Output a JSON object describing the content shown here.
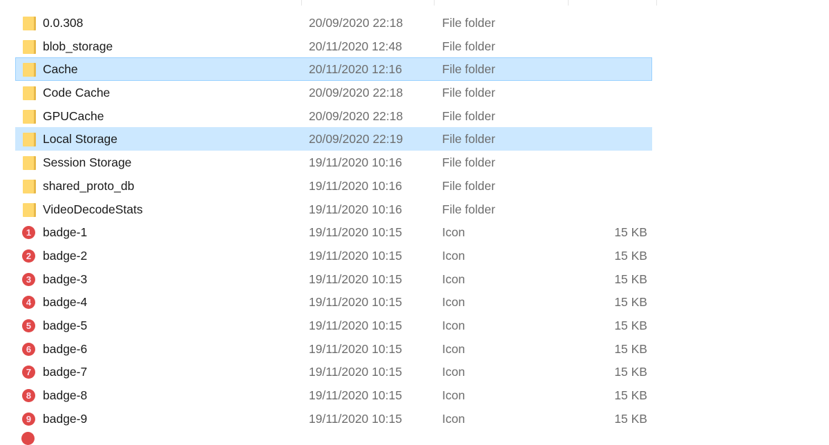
{
  "accent_selection": "#cce8ff",
  "badge_color": "#e04848",
  "files": [
    {
      "name": "0.0.308",
      "date": "20/09/2020 22:18",
      "type": "File folder",
      "size": "",
      "icon": "folder-icon"
    },
    {
      "name": "blob_storage",
      "date": "20/11/2020 12:48",
      "type": "File folder",
      "size": "",
      "icon": "folder-icon"
    },
    {
      "name": "Cache",
      "date": "20/11/2020 12:16",
      "type": "File folder",
      "size": "",
      "icon": "folder-icon",
      "state": "selected-focused"
    },
    {
      "name": "Code Cache",
      "date": "20/09/2020 22:18",
      "type": "File folder",
      "size": "",
      "icon": "folder-icon"
    },
    {
      "name": "GPUCache",
      "date": "20/09/2020 22:18",
      "type": "File folder",
      "size": "",
      "icon": "folder-icon"
    },
    {
      "name": "Local Storage",
      "date": "20/09/2020 22:19",
      "type": "File folder",
      "size": "",
      "icon": "folder-icon",
      "state": "selected"
    },
    {
      "name": "Session Storage",
      "date": "19/11/2020 10:16",
      "type": "File folder",
      "size": "",
      "icon": "folder-icon"
    },
    {
      "name": "shared_proto_db",
      "date": "19/11/2020 10:16",
      "type": "File folder",
      "size": "",
      "icon": "folder-icon"
    },
    {
      "name": "VideoDecodeStats",
      "date": "19/11/2020 10:16",
      "type": "File folder",
      "size": "",
      "icon": "folder-icon"
    },
    {
      "name": "badge-1",
      "date": "19/11/2020 10:15",
      "type": "Icon",
      "size": "15 KB",
      "icon": "badge-icon",
      "badge": "1"
    },
    {
      "name": "badge-2",
      "date": "19/11/2020 10:15",
      "type": "Icon",
      "size": "15 KB",
      "icon": "badge-icon",
      "badge": "2"
    },
    {
      "name": "badge-3",
      "date": "19/11/2020 10:15",
      "type": "Icon",
      "size": "15 KB",
      "icon": "badge-icon",
      "badge": "3"
    },
    {
      "name": "badge-4",
      "date": "19/11/2020 10:15",
      "type": "Icon",
      "size": "15 KB",
      "icon": "badge-icon",
      "badge": "4"
    },
    {
      "name": "badge-5",
      "date": "19/11/2020 10:15",
      "type": "Icon",
      "size": "15 KB",
      "icon": "badge-icon",
      "badge": "5"
    },
    {
      "name": "badge-6",
      "date": "19/11/2020 10:15",
      "type": "Icon",
      "size": "15 KB",
      "icon": "badge-icon",
      "badge": "6"
    },
    {
      "name": "badge-7",
      "date": "19/11/2020 10:15",
      "type": "Icon",
      "size": "15 KB",
      "icon": "badge-icon",
      "badge": "7"
    },
    {
      "name": "badge-8",
      "date": "19/11/2020 10:15",
      "type": "Icon",
      "size": "15 KB",
      "icon": "badge-icon",
      "badge": "8"
    },
    {
      "name": "badge-9",
      "date": "19/11/2020 10:15",
      "type": "Icon",
      "size": "15 KB",
      "icon": "badge-icon",
      "badge": "9"
    }
  ]
}
